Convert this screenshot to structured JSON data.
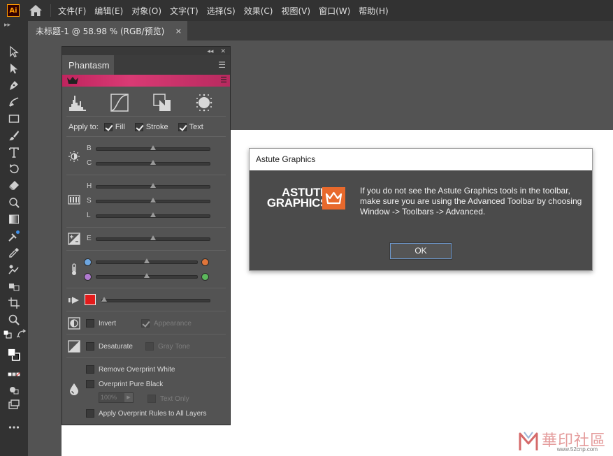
{
  "app": {
    "logo_text": "Ai",
    "menu": [
      "文件(F)",
      "编辑(E)",
      "对象(O)",
      "文字(T)",
      "选择(S)",
      "效果(C)",
      "视图(V)",
      "窗口(W)",
      "帮助(H)"
    ]
  },
  "document_tab": {
    "title": "未标题-1 @ 58.98 % (RGB/预览)",
    "close": "×"
  },
  "panel": {
    "title": "Phantasm",
    "apply_to_label": "Apply to:",
    "apply_fill": "Fill",
    "apply_stroke": "Stroke",
    "apply_text": "Text",
    "slider_labels": {
      "b": "B",
      "c": "C",
      "h": "H",
      "s": "S",
      "l": "L",
      "e": "E"
    },
    "invert_label": "Invert",
    "appearance_label": "Appearance",
    "desaturate_label": "Desaturate",
    "gray_tone_label": "Gray Tone",
    "remove_overprint_white": "Remove Overprint White",
    "overprint_pure_black": "Overprint Pure Black",
    "overprint_percent": "100%",
    "text_only_label": "Text Only",
    "apply_overprint_rules": "Apply Overprint Rules to All Layers",
    "colors": {
      "accent_bar": "#c7296a",
      "temp_blue": "#6ea6e0",
      "temp_orange": "#e0753a",
      "temp_purple": "#b07ad0",
      "temp_green": "#5cb85c",
      "target_color": "#e31b1b"
    }
  },
  "dialog": {
    "title": "Astute Graphics",
    "logo_line1": "ASTUTE",
    "logo_line2": "GRAPHICS",
    "message": "If you do not see the Astute Graphics tools in the toolbar, make sure you are using the Advanced Toolbar by choosing Window -> Toolbars -> Advanced.",
    "ok_label": "OK"
  },
  "watermark": {
    "text": "華印社區",
    "url": "www.52cnp.com"
  }
}
